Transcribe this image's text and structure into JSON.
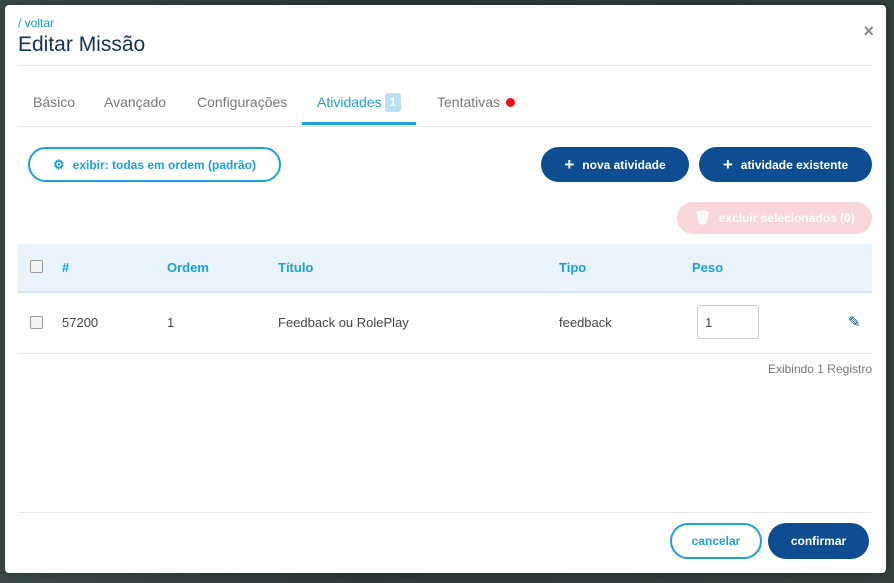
{
  "header": {
    "back_label": "/ voltar",
    "title": "Editar Missão",
    "close_glyph": "×"
  },
  "tabs": [
    {
      "label": "Básico",
      "active": false
    },
    {
      "label": "Avançado",
      "active": false
    },
    {
      "label": "Configurações",
      "active": false
    },
    {
      "label": "Atividades",
      "active": true,
      "badge": "1"
    },
    {
      "label": "Tentativas",
      "active": false,
      "indicator": "red-dot"
    }
  ],
  "toolbar": {
    "display_label": "exibir: todas em ordem (padrão)",
    "new_activity_label": "nova atividade",
    "existing_activity_label": "atividade existente",
    "delete_selected_label": "excluir selecionados (0)"
  },
  "table": {
    "columns": [
      "#",
      "Ordem",
      "Título",
      "Tipo",
      "Peso"
    ],
    "rows": [
      {
        "id": "57200",
        "order": "1",
        "title": "Feedback ou RolePlay",
        "type": "feedback",
        "weight": "1"
      }
    ],
    "count_label": "Exibindo 1 Registro"
  },
  "footer": {
    "cancel_label": "cancelar",
    "confirm_label": "confirmar"
  },
  "colors": {
    "accent": "#1aa1de",
    "primary": "#0f4d92",
    "title": "#12325a",
    "badge": "#b9e1f5",
    "alert": "#ee1111"
  }
}
